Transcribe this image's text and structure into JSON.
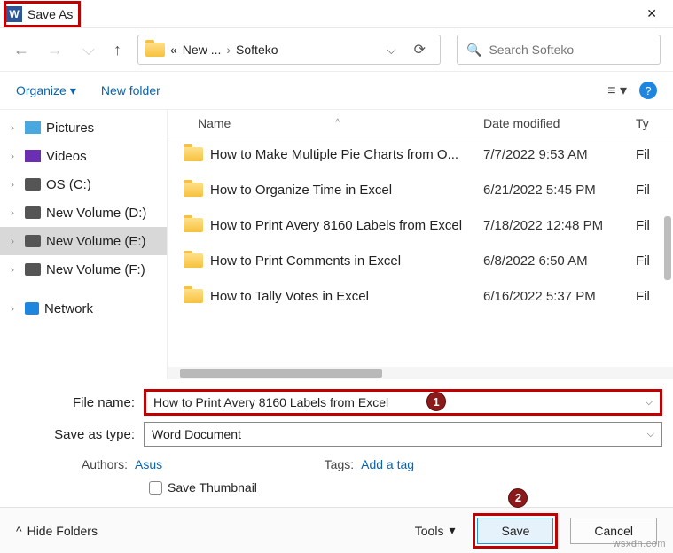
{
  "titlebar": {
    "title": "Save As",
    "app_letter": "W",
    "close": "✕"
  },
  "nav": {
    "back": "←",
    "fwd": "→",
    "recent_drop": "⌵",
    "up": "↑",
    "crumb_prefix": "«",
    "crumb1": "New ...",
    "sep": "›",
    "crumb2": "Softeko",
    "bc_drop": "⌵",
    "refresh": "⟳",
    "search_placeholder": "Search Softeko",
    "search_icon": "🔍"
  },
  "toolbar": {
    "organize": "Organize",
    "organize_caret": "▾",
    "newfolder": "New folder",
    "view_icon": "≡ ▾",
    "help": "?"
  },
  "sidebar": {
    "items": [
      {
        "chev": "›",
        "icon": "ico-pic",
        "label": "Pictures"
      },
      {
        "chev": "›",
        "icon": "ico-vid",
        "label": "Videos"
      },
      {
        "chev": "›",
        "icon": "ico-drv",
        "label": "OS (C:)"
      },
      {
        "chev": "›",
        "icon": "ico-drv",
        "label": "New Volume (D:)"
      },
      {
        "chev": "›",
        "icon": "ico-drv",
        "label": "New Volume (E:)",
        "sel": true
      },
      {
        "chev": "›",
        "icon": "ico-drv",
        "label": "New Volume (F:)"
      },
      {
        "chev": "›",
        "icon": "ico-net",
        "label": "Network",
        "gap": true
      }
    ]
  },
  "columns": {
    "name": "Name",
    "sort": "^",
    "date": "Date modified",
    "type": "Ty"
  },
  "files": [
    {
      "name": "How to Make Multiple Pie Charts from O...",
      "date": "7/7/2022 9:53 AM",
      "type": "Fil"
    },
    {
      "name": "How to Organize Time in Excel",
      "date": "6/21/2022 5:45 PM",
      "type": "Fil"
    },
    {
      "name": "How to Print Avery 8160 Labels from Excel",
      "date": "7/18/2022 12:48 PM",
      "type": "Fil"
    },
    {
      "name": "How to Print Comments in Excel",
      "date": "6/8/2022 6:50 AM",
      "type": "Fil"
    },
    {
      "name": "How to Tally Votes in Excel",
      "date": "6/16/2022 5:37 PM",
      "type": "Fil"
    }
  ],
  "form": {
    "filename_label": "File name:",
    "filename_value": "How to Print Avery 8160 Labels from Excel",
    "savetype_label": "Save as type:",
    "savetype_value": "Word Document",
    "authors_label": "Authors:",
    "authors_value": "Asus",
    "tags_label": "Tags:",
    "tags_value": "Add a tag",
    "thumb_label": "Save Thumbnail",
    "drop": "⌵"
  },
  "footer": {
    "hide_chev": "^",
    "hide_label": "Hide Folders",
    "tools": "Tools",
    "tools_caret": "▾",
    "save": "Save",
    "cancel": "Cancel"
  },
  "callouts": {
    "c1": "1",
    "c2": "2"
  },
  "watermark": "wsxdn.com"
}
